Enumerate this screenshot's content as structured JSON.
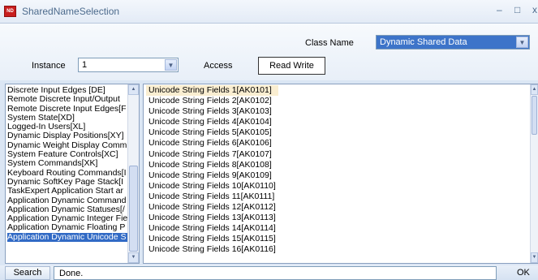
{
  "window": {
    "title": "SharedNameSelection",
    "icon_text": "ND",
    "minimize_glyph": "–",
    "maximize_glyph": "□",
    "close_glyph": "x"
  },
  "form": {
    "class_name_label": "Class Name",
    "class_name_value": "Dynamic Shared Data",
    "instance_label": "Instance",
    "instance_value": "1",
    "access_label": "Access",
    "access_value": "Read Write"
  },
  "left_list": {
    "items": [
      "Discrete Input Edges [DE]",
      "Remote Discrete Input/Output",
      "Remote Discrete Input Edges[F",
      "System State[XD]",
      "Logged-In Users[XL]",
      "Dynamic Display Positions[XY]",
      "Dynamic Weight Display Comm",
      "System Feature Controls[XC]",
      "System Commands[XK]",
      "Keyboard Routing Commands[I",
      "Dynamic SoftKey Page Stack[I",
      "TaskExpert Application Start ar",
      "Application Dynamic Command",
      "Application Dynamic Statuses[/",
      "Application Dynamic Integer Fie",
      "Application Dynamic Floating P",
      "Application Dynamic Unicode S"
    ],
    "selected_index": 16,
    "scroll_up_glyph": "▲",
    "scroll_down_glyph": "▼"
  },
  "right_list": {
    "items": [
      "Unicode String Fields 1[AK0101]",
      "Unicode String Fields 2[AK0102]",
      "Unicode String Fields 3[AK0103]",
      "Unicode String Fields 4[AK0104]",
      "Unicode String Fields 5[AK0105]",
      "Unicode String Fields 6[AK0106]",
      "Unicode String Fields 7[AK0107]",
      "Unicode String Fields 8[AK0108]",
      "Unicode String Fields 9[AK0109]",
      "Unicode String Fields 10[AK0110]",
      "Unicode String Fields 11[AK0111]",
      "Unicode String Fields 12[AK0112]",
      "Unicode String Fields 13[AK0113]",
      "Unicode String Fields 14[AK0114]",
      "Unicode String Fields 15[AK0115]",
      "Unicode String Fields 16[AK0116]"
    ],
    "selected_index": 0,
    "scroll_up_glyph": "▲",
    "scroll_down_glyph": "▼"
  },
  "bottom": {
    "search_label": "Search",
    "status_text": "Done.",
    "ok_label": "OK"
  },
  "colors": {
    "selection_blue": "#316ac5",
    "hover_highlight": "#faeed1",
    "title_text": "#4d6b8d"
  }
}
